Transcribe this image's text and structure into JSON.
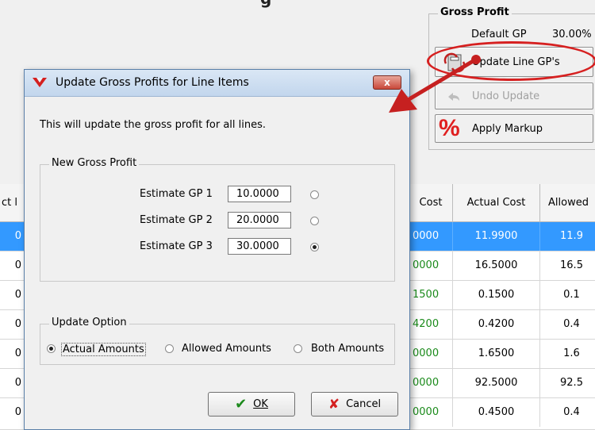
{
  "app": {
    "title_fragment": "g"
  },
  "gross_profit_panel": {
    "title": "Gross Profit",
    "default_gp_label": "Default GP",
    "default_gp_value": "30.00%",
    "update_button": "Update Line GP's",
    "undo_button": "Undo Update",
    "markup_button": "Apply Markup"
  },
  "grid": {
    "columns": {
      "first": "ct l",
      "cost": "Cost",
      "actual": "Actual Cost",
      "allowed": "Allowed"
    },
    "rows": [
      {
        "first": "0",
        "cost": "0000",
        "actual": "11.9900",
        "allowed": "11.9",
        "selected": true
      },
      {
        "first": "0",
        "cost": "0000",
        "actual": "16.5000",
        "allowed": "16.5",
        "selected": false
      },
      {
        "first": "0",
        "cost": "1500",
        "actual": "0.1500",
        "allowed": "0.1",
        "selected": false
      },
      {
        "first": "0",
        "cost": "4200",
        "actual": "0.4200",
        "allowed": "0.4",
        "selected": false
      },
      {
        "first": "0",
        "cost": "0000",
        "actual": "1.6500",
        "allowed": "1.6",
        "selected": false
      },
      {
        "first": "0",
        "cost": "0000",
        "actual": "92.5000",
        "allowed": "92.5",
        "selected": false
      },
      {
        "first": "0",
        "cost": "0000",
        "actual": "0.4500",
        "allowed": "0.4",
        "selected": false
      }
    ]
  },
  "dialog": {
    "title": "Update Gross Profits for Line Items",
    "close_label": "x",
    "message": "This will update the gross profit for all lines.",
    "new_gp_group": "New Gross Profit",
    "estimates": [
      {
        "label": "Estimate GP 1",
        "value": "10.0000",
        "selected": false
      },
      {
        "label": "Estimate GP 2",
        "value": "20.0000",
        "selected": false
      },
      {
        "label": "Estimate GP 3",
        "value": "30.0000",
        "selected": true
      }
    ],
    "update_option_group": "Update Option",
    "options": {
      "actual": "Actual Amounts",
      "allowed": "Allowed Amounts",
      "both": "Both Amounts",
      "selected": "actual"
    },
    "ok_label": "OK",
    "cancel_label": "Cancel"
  },
  "colors": {
    "selection": "#3399ff",
    "highlight": "#d62020",
    "cost_text": "#1a8a1a"
  }
}
